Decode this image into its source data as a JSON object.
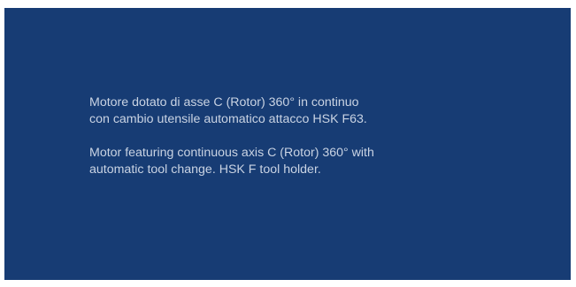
{
  "panel": {
    "background_color": "#173c74",
    "text_color": "#c9d3e3",
    "description_it": "Motore dotato di asse C (Rotor) 360° in continuo\ncon cambio utensile automatico attacco HSK F63.",
    "description_en": "Motor featuring continuous axis C (Rotor) 360° with\nautomatic tool change. HSK F tool holder."
  }
}
